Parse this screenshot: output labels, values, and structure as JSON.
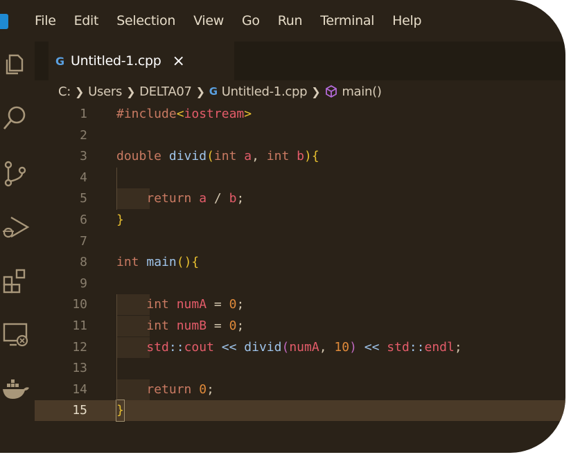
{
  "menu": [
    "File",
    "Edit",
    "Selection",
    "View",
    "Go",
    "Run",
    "Terminal",
    "Help"
  ],
  "tab": {
    "file_icon": "G",
    "label": "Untitled-1.cpp",
    "close": "×"
  },
  "breadcrumb": {
    "drive": "C:",
    "users": "Users",
    "user": "DELTA07",
    "file_icon": "G",
    "file": "Untitled-1.cpp",
    "symbol": "main()"
  },
  "activity_icons": [
    "explorer-icon",
    "search-icon",
    "source-control-icon",
    "run-debug-icon",
    "extensions-icon",
    "remote-explorer-icon",
    "docker-icon"
  ],
  "code_lines": [
    {
      "n": "1",
      "t": "#include<iostream>"
    },
    {
      "n": "2",
      "t": ""
    },
    {
      "n": "3",
      "t": "double divid(int a, int b){"
    },
    {
      "n": "4",
      "t": ""
    },
    {
      "n": "5",
      "t": "    return a / b;"
    },
    {
      "n": "6",
      "t": "}"
    },
    {
      "n": "7",
      "t": ""
    },
    {
      "n": "8",
      "t": "int main(){"
    },
    {
      "n": "9",
      "t": ""
    },
    {
      "n": "10",
      "t": "    int numA = 0;"
    },
    {
      "n": "11",
      "t": "    int numB = 0;"
    },
    {
      "n": "12",
      "t": "    std::cout << divid(numA, 10) << std::endl;"
    },
    {
      "n": "13",
      "t": ""
    },
    {
      "n": "14",
      "t": "    return 0;"
    },
    {
      "n": "15",
      "t": "}"
    }
  ],
  "active_line": "15",
  "colors": {
    "keyword": "#c97a62",
    "number": "#e08a3a",
    "function": "#9fc4ea",
    "variable": "#e45c6a",
    "bracket": "#e8c030",
    "background": "#2a2218"
  }
}
